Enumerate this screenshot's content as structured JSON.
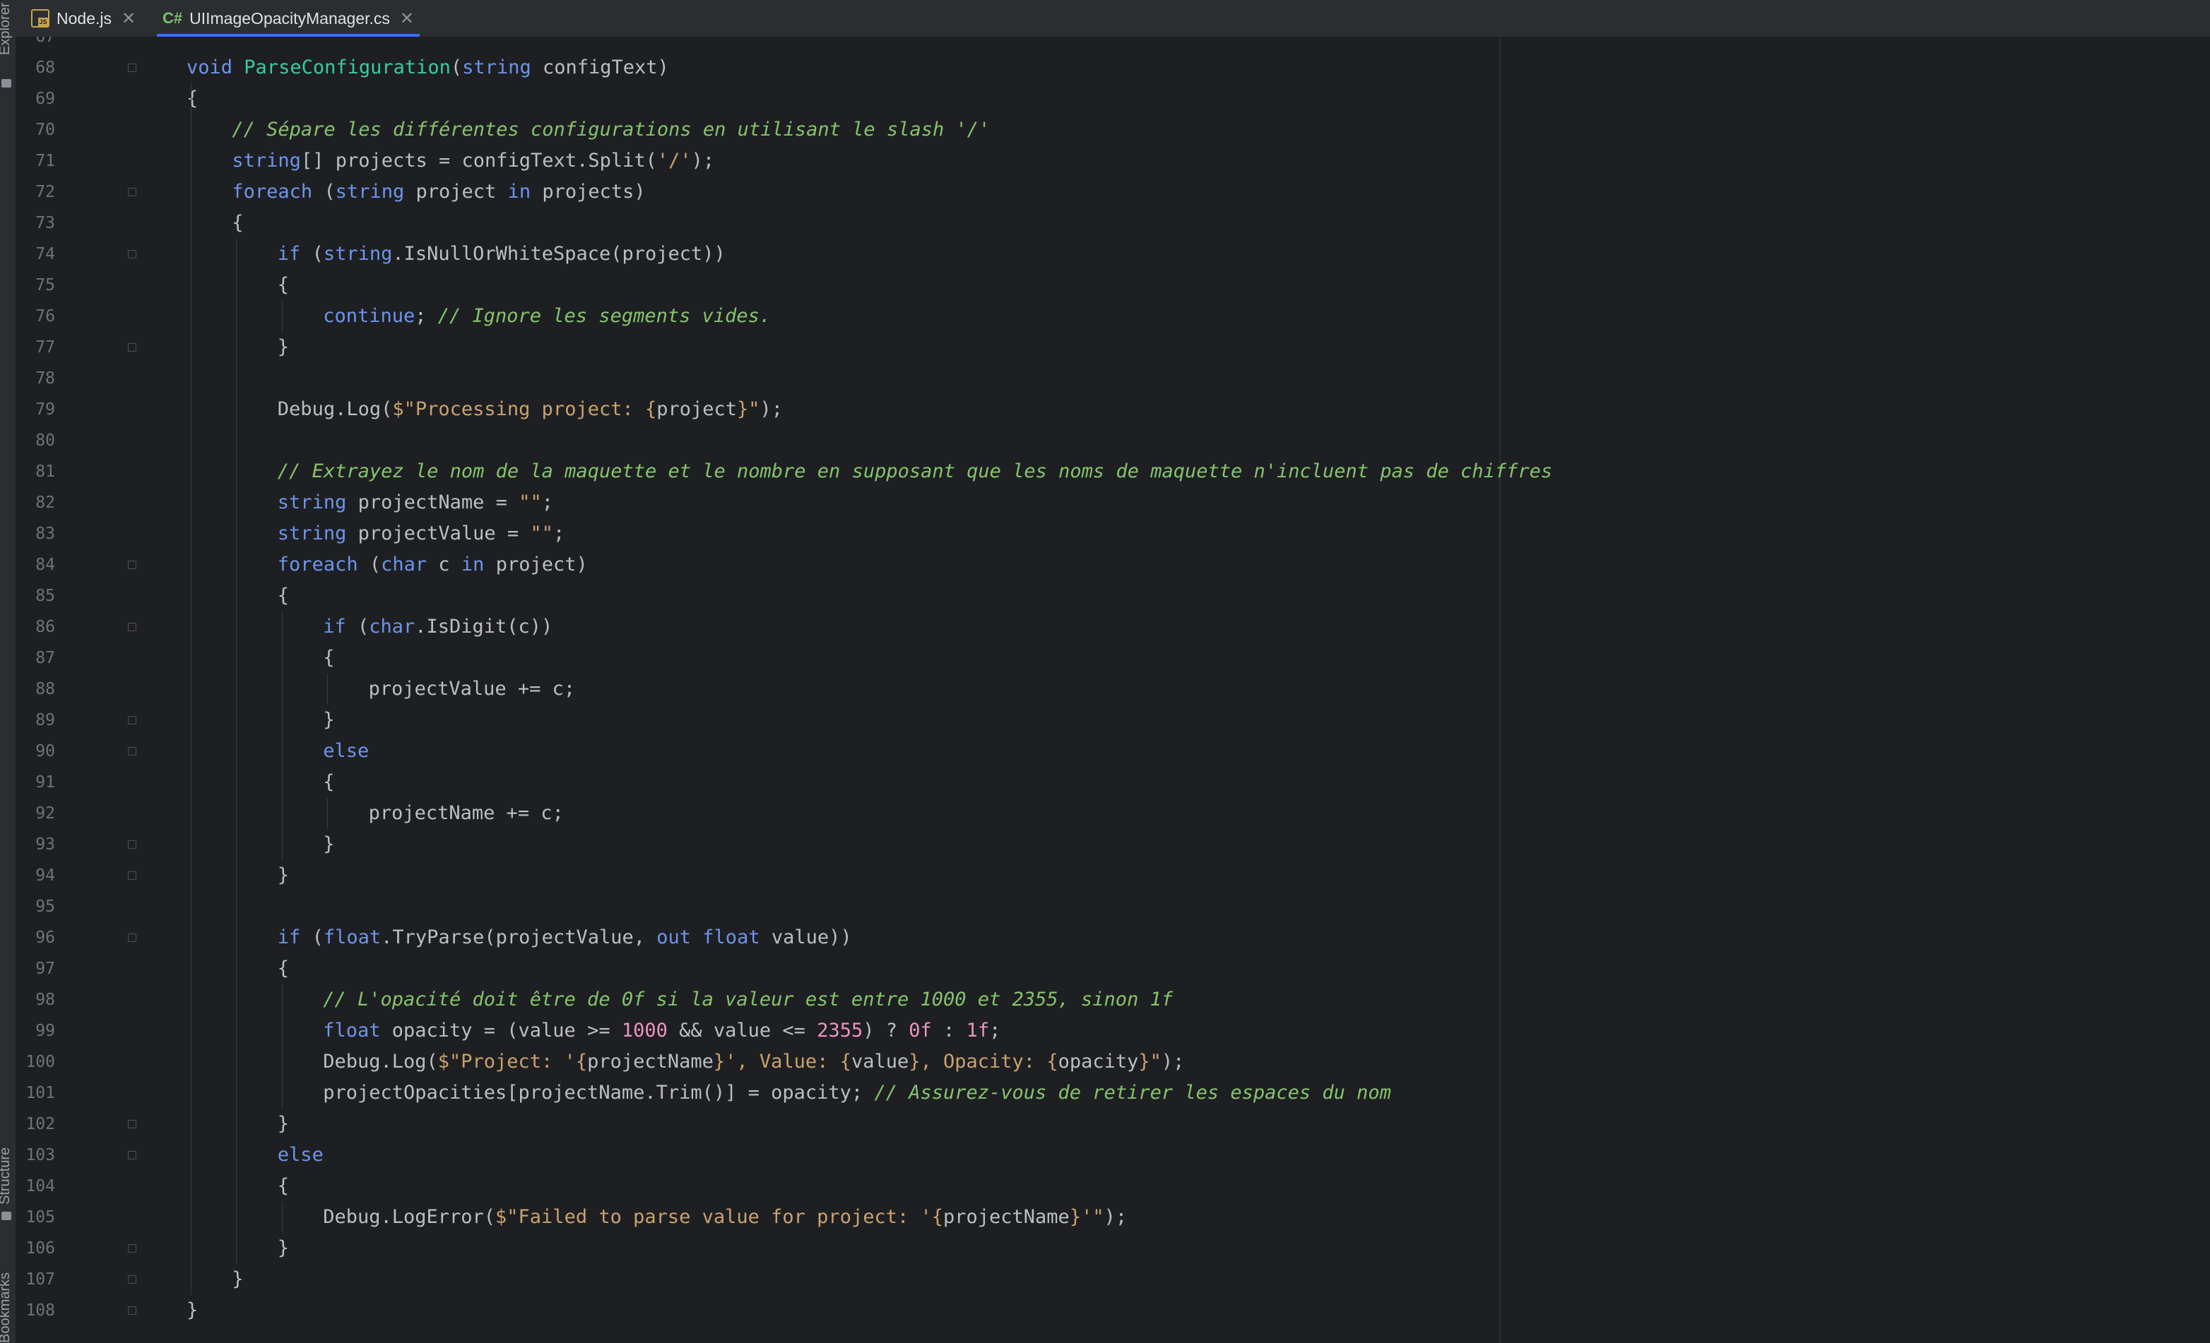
{
  "tool_windows": {
    "explorer": "Explorer",
    "structure": "Structure",
    "bookmarks": "Bookmarks"
  },
  "tabs": [
    {
      "label": "Node.js",
      "icon": "js-file-icon",
      "active": false
    },
    {
      "label": "UIImageOpacityManager.cs",
      "icon": "csharp-file-icon",
      "active": true
    }
  ],
  "editor": {
    "partial_top_line": "67",
    "partial_bottom_line": "109",
    "lines": [
      {
        "n": "68",
        "indent": 0,
        "fold": true,
        "tokens": [
          [
            "kw",
            "void"
          ],
          [
            "p",
            " "
          ],
          [
            "fn",
            "ParseConfiguration"
          ],
          [
            "p",
            "("
          ],
          [
            "kw",
            "string"
          ],
          [
            "p",
            " configText)"
          ]
        ]
      },
      {
        "n": "69",
        "indent": 0,
        "fold": false,
        "tokens": [
          [
            "p",
            "{"
          ]
        ]
      },
      {
        "n": "70",
        "indent": 1,
        "fold": false,
        "tokens": [
          [
            "cm",
            "// Sépare les différentes configurations en utilisant le slash '/'"
          ]
        ]
      },
      {
        "n": "71",
        "indent": 1,
        "fold": false,
        "tokens": [
          [
            "kw",
            "string"
          ],
          [
            "p",
            "[] projects = configText.Split("
          ],
          [
            "str",
            "'/'"
          ],
          [
            "p",
            ");"
          ]
        ]
      },
      {
        "n": "72",
        "indent": 1,
        "fold": true,
        "tokens": [
          [
            "kw",
            "foreach"
          ],
          [
            "p",
            " ("
          ],
          [
            "kw",
            "string"
          ],
          [
            "p",
            " project "
          ],
          [
            "kw",
            "in"
          ],
          [
            "p",
            " projects)"
          ]
        ]
      },
      {
        "n": "73",
        "indent": 1,
        "fold": false,
        "tokens": [
          [
            "p",
            "{"
          ]
        ]
      },
      {
        "n": "74",
        "indent": 2,
        "fold": true,
        "tokens": [
          [
            "kw",
            "if"
          ],
          [
            "p",
            " ("
          ],
          [
            "kw",
            "string"
          ],
          [
            "p",
            ".IsNullOrWhiteSpace(project))"
          ]
        ]
      },
      {
        "n": "75",
        "indent": 2,
        "fold": false,
        "tokens": [
          [
            "p",
            "{"
          ]
        ]
      },
      {
        "n": "76",
        "indent": 3,
        "fold": false,
        "tokens": [
          [
            "kw",
            "continue"
          ],
          [
            "p",
            "; "
          ],
          [
            "cm",
            "// Ignore les segments vides."
          ]
        ]
      },
      {
        "n": "77",
        "indent": 2,
        "fold": true,
        "tokens": [
          [
            "p",
            "}"
          ]
        ]
      },
      {
        "n": "78",
        "indent": 2,
        "fold": false,
        "tokens": []
      },
      {
        "n": "79",
        "indent": 2,
        "fold": false,
        "tokens": [
          [
            "p",
            "Debug.Log("
          ],
          [
            "str",
            "$\"Processing project: {"
          ],
          [
            "p",
            "project"
          ],
          [
            "str",
            "}\""
          ],
          [
            "p",
            ");"
          ]
        ]
      },
      {
        "n": "80",
        "indent": 2,
        "fold": false,
        "tokens": []
      },
      {
        "n": "81",
        "indent": 2,
        "fold": false,
        "tokens": [
          [
            "cm",
            "// Extrayez le nom de la maquette et le nombre en supposant que les noms de maquette n'incluent pas de chiffres"
          ]
        ]
      },
      {
        "n": "82",
        "indent": 2,
        "fold": false,
        "tokens": [
          [
            "kw",
            "string"
          ],
          [
            "p",
            " projectName = "
          ],
          [
            "str",
            "\"\""
          ],
          [
            "p",
            ";"
          ]
        ]
      },
      {
        "n": "83",
        "indent": 2,
        "fold": false,
        "tokens": [
          [
            "kw",
            "string"
          ],
          [
            "p",
            " projectValue = "
          ],
          [
            "str",
            "\"\""
          ],
          [
            "p",
            ";"
          ]
        ]
      },
      {
        "n": "84",
        "indent": 2,
        "fold": true,
        "tokens": [
          [
            "kw",
            "foreach"
          ],
          [
            "p",
            " ("
          ],
          [
            "kw",
            "char"
          ],
          [
            "p",
            " c "
          ],
          [
            "kw",
            "in"
          ],
          [
            "p",
            " project)"
          ]
        ]
      },
      {
        "n": "85",
        "indent": 2,
        "fold": false,
        "tokens": [
          [
            "p",
            "{"
          ]
        ]
      },
      {
        "n": "86",
        "indent": 3,
        "fold": true,
        "tokens": [
          [
            "kw",
            "if"
          ],
          [
            "p",
            " ("
          ],
          [
            "kw",
            "char"
          ],
          [
            "p",
            ".IsDigit(c))"
          ]
        ]
      },
      {
        "n": "87",
        "indent": 3,
        "fold": false,
        "tokens": [
          [
            "p",
            "{"
          ]
        ]
      },
      {
        "n": "88",
        "indent": 4,
        "fold": false,
        "tokens": [
          [
            "p",
            "projectValue += c;"
          ]
        ]
      },
      {
        "n": "89",
        "indent": 3,
        "fold": true,
        "tokens": [
          [
            "p",
            "}"
          ]
        ]
      },
      {
        "n": "90",
        "indent": 3,
        "fold": true,
        "tokens": [
          [
            "kw",
            "else"
          ]
        ]
      },
      {
        "n": "91",
        "indent": 3,
        "fold": false,
        "tokens": [
          [
            "p",
            "{"
          ]
        ]
      },
      {
        "n": "92",
        "indent": 4,
        "fold": false,
        "tokens": [
          [
            "p",
            "projectName += c;"
          ]
        ]
      },
      {
        "n": "93",
        "indent": 3,
        "fold": true,
        "tokens": [
          [
            "p",
            "}"
          ]
        ]
      },
      {
        "n": "94",
        "indent": 2,
        "fold": true,
        "tokens": [
          [
            "p",
            "}"
          ]
        ]
      },
      {
        "n": "95",
        "indent": 2,
        "fold": false,
        "tokens": []
      },
      {
        "n": "96",
        "indent": 2,
        "fold": true,
        "tokens": [
          [
            "kw",
            "if"
          ],
          [
            "p",
            " ("
          ],
          [
            "kw",
            "float"
          ],
          [
            "p",
            ".TryParse(projectValue, "
          ],
          [
            "kw",
            "out"
          ],
          [
            "p",
            " "
          ],
          [
            "kw",
            "float"
          ],
          [
            "p",
            " value))"
          ]
        ]
      },
      {
        "n": "97",
        "indent": 2,
        "fold": false,
        "tokens": [
          [
            "p",
            "{"
          ]
        ]
      },
      {
        "n": "98",
        "indent": 3,
        "fold": false,
        "tokens": [
          [
            "cm",
            "// L'opacité doit être de 0f si la valeur est entre 1000 et 2355, sinon 1f"
          ]
        ]
      },
      {
        "n": "99",
        "indent": 3,
        "fold": false,
        "tokens": [
          [
            "kw",
            "float"
          ],
          [
            "p",
            " opacity = (value >= "
          ],
          [
            "num",
            "1000"
          ],
          [
            "p",
            " && value <= "
          ],
          [
            "num",
            "2355"
          ],
          [
            "p",
            ") ? "
          ],
          [
            "num",
            "0f"
          ],
          [
            "p",
            " : "
          ],
          [
            "num",
            "1f"
          ],
          [
            "p",
            ";"
          ]
        ]
      },
      {
        "n": "100",
        "indent": 3,
        "fold": false,
        "tokens": [
          [
            "p",
            "Debug.Log("
          ],
          [
            "str",
            "$\"Project: '{"
          ],
          [
            "p",
            "projectName"
          ],
          [
            "str",
            "}', Value: {"
          ],
          [
            "p",
            "value"
          ],
          [
            "str",
            "}, Opacity: {"
          ],
          [
            "p",
            "opacity"
          ],
          [
            "str",
            "}\""
          ],
          [
            "p",
            ");"
          ]
        ]
      },
      {
        "n": "101",
        "indent": 3,
        "fold": false,
        "tokens": [
          [
            "p",
            "projectOpacities[projectName.Trim()] = opacity; "
          ],
          [
            "cm",
            "// Assurez-vous de retirer les espaces du nom"
          ]
        ]
      },
      {
        "n": "102",
        "indent": 2,
        "fold": true,
        "tokens": [
          [
            "p",
            "}"
          ]
        ]
      },
      {
        "n": "103",
        "indent": 2,
        "fold": true,
        "tokens": [
          [
            "kw",
            "else"
          ]
        ]
      },
      {
        "n": "104",
        "indent": 2,
        "fold": false,
        "tokens": [
          [
            "p",
            "{"
          ]
        ]
      },
      {
        "n": "105",
        "indent": 3,
        "fold": false,
        "tokens": [
          [
            "p",
            "Debug.LogError("
          ],
          [
            "str",
            "$\"Failed to parse value for project: '{"
          ],
          [
            "p",
            "projectName"
          ],
          [
            "str",
            "}'\""
          ],
          [
            "p",
            ");"
          ]
        ]
      },
      {
        "n": "106",
        "indent": 2,
        "fold": true,
        "tokens": [
          [
            "p",
            "}"
          ]
        ]
      },
      {
        "n": "107",
        "indent": 1,
        "fold": true,
        "tokens": [
          [
            "p",
            "}"
          ]
        ]
      },
      {
        "n": "108",
        "indent": 0,
        "fold": true,
        "tokens": [
          [
            "p",
            "}"
          ]
        ]
      }
    ]
  }
}
